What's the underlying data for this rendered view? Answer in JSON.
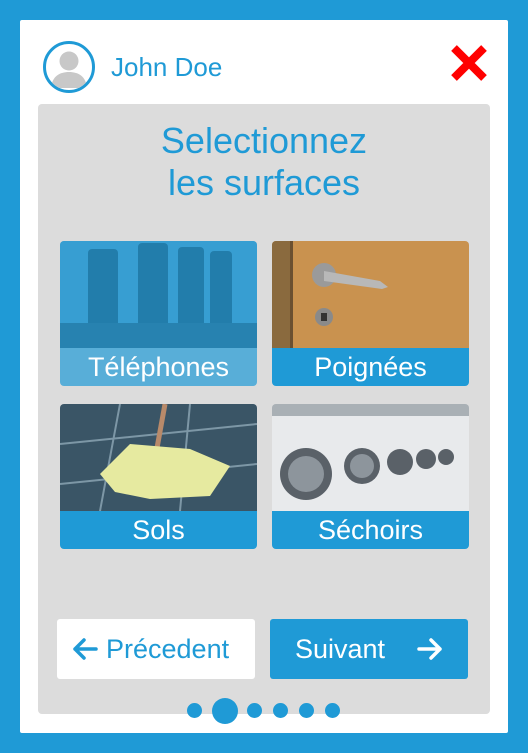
{
  "user": {
    "name": "John Doe",
    "avatar_icon": "user-avatar-icon"
  },
  "header": {
    "close_icon": "close-icon",
    "close_color": "#ff0000"
  },
  "main": {
    "title_line1": "Selectionnez",
    "title_line2": "les surfaces",
    "surfaces": [
      {
        "label": "Téléphones",
        "selected": true
      },
      {
        "label": "Poignées",
        "selected": false
      },
      {
        "label": "Sols",
        "selected": false
      },
      {
        "label": "Séchoirs",
        "selected": false
      }
    ]
  },
  "nav": {
    "prev_label": "Précedent",
    "next_label": "Suivant",
    "pages": 6,
    "current_page": 2
  },
  "colors": {
    "accent": "#1f9ad6",
    "panel": "#dcdcdc",
    "close": "#ff0000"
  }
}
